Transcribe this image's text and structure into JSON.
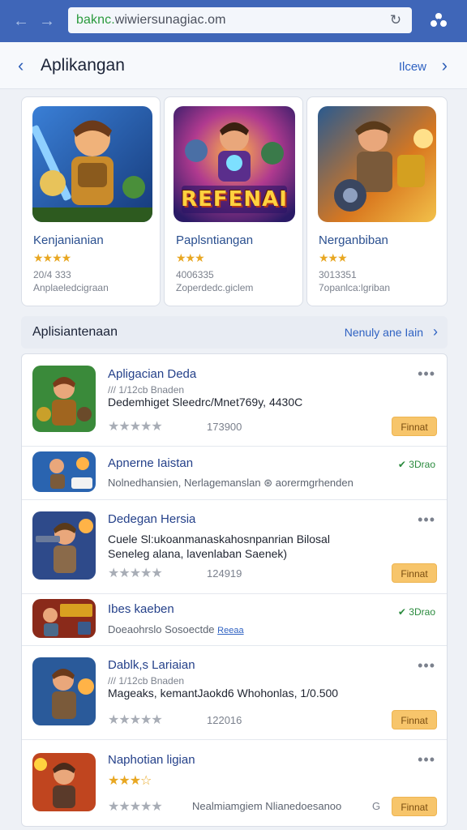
{
  "browser": {
    "url_scheme": "baknc.",
    "url_rest": "wiwiersunagiac.om",
    "back_glyph": "←",
    "forward_glyph": "→",
    "reload_glyph": "↻"
  },
  "header": {
    "back_glyph": "‹",
    "title": "Aplikangan",
    "link": "Ilcew",
    "link_chevron": "›"
  },
  "featured": [
    {
      "name": "Kenjanianian",
      "stars": "★★★★",
      "meta1": "20/4 333",
      "meta2": "Anplaeledcigraan"
    },
    {
      "name": "Paplsntiangan",
      "stars": "★★★",
      "meta1": "4006335",
      "meta2": "Zoperdedc.giclem",
      "art_text": "REFENAI"
    },
    {
      "name": "Nerganbiban",
      "stars": "★★★",
      "meta1": "3013351",
      "meta2": "7opanlca:lgriban"
    }
  ],
  "section": {
    "title": "Aplisiantenaan",
    "link": "Nenuly ane Iain",
    "chevron": "›"
  },
  "list": [
    {
      "title": "Apligacian Deda",
      "sub": "/// 1/12cb Bnaden",
      "line1": "Dedemhiget Sleedrc/Mnet769y, 4430C",
      "stars": "★★★★★",
      "count": "173900",
      "button": "Finnat",
      "dots": "•••"
    },
    {
      "title": "Apnerne Iaistan",
      "meta": "Nolnedhansien,  Nerlagemanslan  ⊛  aorermgrhenden",
      "tag": "✔ 3Drao"
    },
    {
      "title": "Dedegan Hersia",
      "line1": "Cuele Sl:ukoanmanaskahosnpanrian Bilosal",
      "line2": "Seneleg alana, lavenlaban Saenek)",
      "stars": "★★★★★",
      "count": "124919",
      "button": "Finnat",
      "dots": "•••"
    },
    {
      "title": "Ibes kaeben",
      "meta": "Doeaohrslo Sosoectde",
      "meta_link": "Reeaa",
      "tag": "✔ 3Drao"
    },
    {
      "title": "Dablk,s Lariaian",
      "sub": "/// 1/12cb Bnaden",
      "line1": "Mageaks, kemantJaokd6 Whohonlas,  1/0.500",
      "stars": "★★★★★",
      "count": "122016",
      "button": "Finnat",
      "dots": "•••"
    },
    {
      "title": "Naphotian ligian",
      "stars_gold": "★★★☆",
      "meta": "Nealmiamgiem  Nlianedoesanoo",
      "stars": "★★★★★",
      "button": "Finnat",
      "dots": "•••",
      "g": "G"
    }
  ],
  "colors": {
    "browser_bar": "#3f66b8",
    "accent": "#2f62c2",
    "star_gold": "#e8a722",
    "button": "#f7c56b"
  }
}
